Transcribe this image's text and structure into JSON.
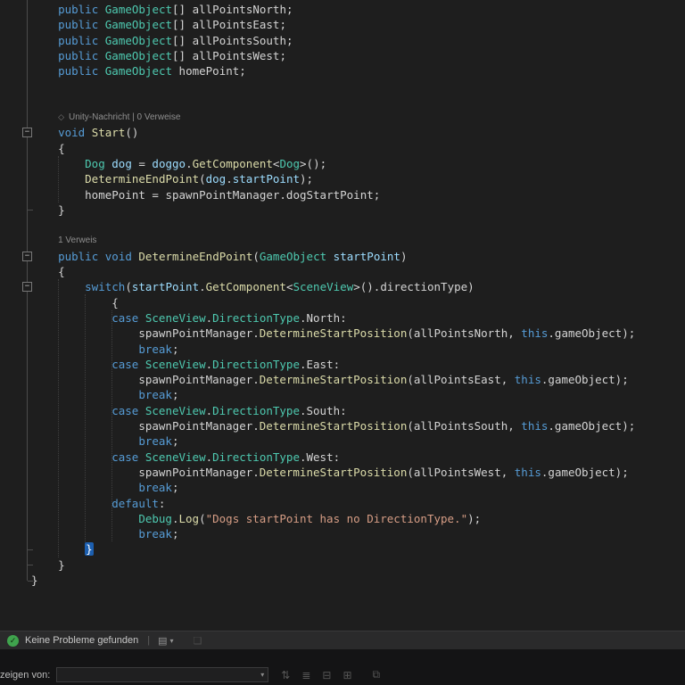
{
  "colors": {
    "editor-bg": "#1E1E1E",
    "kw": "#569CD6",
    "ty": "#4EC9B0",
    "fn": "#DCDCAA",
    "var": "#9CDCFE",
    "str": "#D69D85",
    "pl": "#D4D4D4",
    "lens": "#8F8F8F",
    "brace-hl-bg": "#1C5FB0",
    "check-green": "#3FA34D"
  },
  "editor": {
    "fold_glyph": "−",
    "lens_icon_glyph": "◇",
    "lines": [
      {
        "i": 4,
        "s": [
          [
            "public",
            "kw"
          ],
          [
            " ",
            "pl"
          ],
          [
            "GameObject",
            "ty"
          ],
          [
            "[] ",
            "pl"
          ],
          [
            "allPointsNorth;",
            "pl"
          ]
        ]
      },
      {
        "i": 4,
        "s": [
          [
            "public",
            "kw"
          ],
          [
            " ",
            "pl"
          ],
          [
            "GameObject",
            "ty"
          ],
          [
            "[] ",
            "pl"
          ],
          [
            "allPointsEast;",
            "pl"
          ]
        ]
      },
      {
        "i": 4,
        "s": [
          [
            "public",
            "kw"
          ],
          [
            " ",
            "pl"
          ],
          [
            "GameObject",
            "ty"
          ],
          [
            "[] ",
            "pl"
          ],
          [
            "allPointsSouth;",
            "pl"
          ]
        ]
      },
      {
        "i": 4,
        "s": [
          [
            "public",
            "kw"
          ],
          [
            " ",
            "pl"
          ],
          [
            "GameObject",
            "ty"
          ],
          [
            "[] ",
            "pl"
          ],
          [
            "allPointsWest;",
            "pl"
          ]
        ]
      },
      {
        "i": 4,
        "s": [
          [
            "public",
            "kw"
          ],
          [
            " ",
            "pl"
          ],
          [
            "GameObject",
            "ty"
          ],
          [
            " homePoint;",
            "pl"
          ]
        ]
      },
      {
        "t": "blank"
      },
      {
        "t": "blank"
      },
      {
        "t": "lens",
        "i": 4,
        "icon": true,
        "text": "Unity-Nachricht | 0 Verweise"
      },
      {
        "i": 4,
        "s": [
          [
            "void",
            "kw"
          ],
          [
            " ",
            "pl"
          ],
          [
            "Start",
            "fn"
          ],
          [
            "()",
            "pl"
          ]
        ]
      },
      {
        "i": 4,
        "s": [
          [
            "{",
            "pl"
          ]
        ]
      },
      {
        "i": 8,
        "s": [
          [
            "Dog",
            "ty"
          ],
          [
            " ",
            "pl"
          ],
          [
            "dog",
            "var"
          ],
          [
            " = ",
            "pl"
          ],
          [
            "doggo",
            "var"
          ],
          [
            ".",
            "pl"
          ],
          [
            "GetComponent",
            "fn"
          ],
          [
            "<",
            "pl"
          ],
          [
            "Dog",
            "ty"
          ],
          [
            ">();",
            "pl"
          ]
        ]
      },
      {
        "i": 8,
        "s": [
          [
            "DetermineEndPoint",
            "fn"
          ],
          [
            "(",
            "pl"
          ],
          [
            "dog",
            "var"
          ],
          [
            ".",
            "pl"
          ],
          [
            "startPoint",
            "var"
          ],
          [
            ");",
            "pl"
          ]
        ]
      },
      {
        "i": 8,
        "s": [
          [
            "homePoint = spawnPointManager.dogStartPoint;",
            "pl"
          ]
        ]
      },
      {
        "i": 4,
        "s": [
          [
            "}",
            "pl"
          ]
        ]
      },
      {
        "t": "blank"
      },
      {
        "t": "lens",
        "i": 4,
        "text": "1 Verweis"
      },
      {
        "i": 4,
        "s": [
          [
            "public",
            "kw"
          ],
          [
            " ",
            "pl"
          ],
          [
            "void",
            "kw"
          ],
          [
            " ",
            "pl"
          ],
          [
            "DetermineEndPoint",
            "fn"
          ],
          [
            "(",
            "pl"
          ],
          [
            "GameObject",
            "ty"
          ],
          [
            " ",
            "pl"
          ],
          [
            "startPoint",
            "var"
          ],
          [
            ")",
            "pl"
          ]
        ]
      },
      {
        "i": 4,
        "s": [
          [
            "{",
            "pl"
          ]
        ]
      },
      {
        "i": 8,
        "s": [
          [
            "switch",
            "kw"
          ],
          [
            "(",
            "pl"
          ],
          [
            "startPoint",
            "var"
          ],
          [
            ".",
            "pl"
          ],
          [
            "GetComponent",
            "fn"
          ],
          [
            "<",
            "pl"
          ],
          [
            "SceneView",
            "ty"
          ],
          [
            ">().directionType)",
            "pl"
          ]
        ]
      },
      {
        "i": 12,
        "s": [
          [
            "{",
            "pl"
          ]
        ]
      },
      {
        "i": 12,
        "s": [
          [
            "case",
            "kw"
          ],
          [
            " ",
            "pl"
          ],
          [
            "SceneView",
            "ty"
          ],
          [
            ".",
            "pl"
          ],
          [
            "DirectionType",
            "ty"
          ],
          [
            ".North:",
            "pl"
          ]
        ]
      },
      {
        "i": 16,
        "s": [
          [
            "spawnPointManager.",
            "pl"
          ],
          [
            "DetermineStartPosition",
            "fn"
          ],
          [
            "(allPointsNorth, ",
            "pl"
          ],
          [
            "this",
            "kw"
          ],
          [
            ".gameObject);",
            "pl"
          ]
        ]
      },
      {
        "i": 16,
        "s": [
          [
            "break",
            "kw"
          ],
          [
            ";",
            "pl"
          ]
        ]
      },
      {
        "i": 12,
        "s": [
          [
            "case",
            "kw"
          ],
          [
            " ",
            "pl"
          ],
          [
            "SceneView",
            "ty"
          ],
          [
            ".",
            "pl"
          ],
          [
            "DirectionType",
            "ty"
          ],
          [
            ".East:",
            "pl"
          ]
        ]
      },
      {
        "i": 16,
        "s": [
          [
            "spawnPointManager.",
            "pl"
          ],
          [
            "DetermineStartPosition",
            "fn"
          ],
          [
            "(allPointsEast, ",
            "pl"
          ],
          [
            "this",
            "kw"
          ],
          [
            ".gameObject);",
            "pl"
          ]
        ]
      },
      {
        "i": 16,
        "s": [
          [
            "break",
            "kw"
          ],
          [
            ";",
            "pl"
          ]
        ]
      },
      {
        "i": 12,
        "s": [
          [
            "case",
            "kw"
          ],
          [
            " ",
            "pl"
          ],
          [
            "SceneView",
            "ty"
          ],
          [
            ".",
            "pl"
          ],
          [
            "DirectionType",
            "ty"
          ],
          [
            ".South:",
            "pl"
          ]
        ]
      },
      {
        "i": 16,
        "s": [
          [
            "spawnPointManager.",
            "pl"
          ],
          [
            "DetermineStartPosition",
            "fn"
          ],
          [
            "(allPointsSouth, ",
            "pl"
          ],
          [
            "this",
            "kw"
          ],
          [
            ".gameObject);",
            "pl"
          ]
        ]
      },
      {
        "i": 16,
        "s": [
          [
            "break",
            "kw"
          ],
          [
            ";",
            "pl"
          ]
        ]
      },
      {
        "i": 12,
        "s": [
          [
            "case",
            "kw"
          ],
          [
            " ",
            "pl"
          ],
          [
            "SceneView",
            "ty"
          ],
          [
            ".",
            "pl"
          ],
          [
            "DirectionType",
            "ty"
          ],
          [
            ".West:",
            "pl"
          ]
        ]
      },
      {
        "i": 16,
        "s": [
          [
            "spawnPointManager.",
            "pl"
          ],
          [
            "DetermineStartPosition",
            "fn"
          ],
          [
            "(allPointsWest, ",
            "pl"
          ],
          [
            "this",
            "kw"
          ],
          [
            ".gameObject);",
            "pl"
          ]
        ]
      },
      {
        "i": 16,
        "s": [
          [
            "break",
            "kw"
          ],
          [
            ";",
            "pl"
          ]
        ]
      },
      {
        "i": 12,
        "s": [
          [
            "default",
            "kw"
          ],
          [
            ":",
            "pl"
          ]
        ]
      },
      {
        "i": 16,
        "s": [
          [
            "Debug",
            "ty"
          ],
          [
            ".",
            "pl"
          ],
          [
            "Log",
            "fn"
          ],
          [
            "(",
            "pl"
          ],
          [
            "\"Dogs startPoint has no DirectionType.\"",
            "str"
          ],
          [
            ");",
            "pl"
          ]
        ]
      },
      {
        "i": 16,
        "s": [
          [
            "break",
            "kw"
          ],
          [
            ";",
            "pl"
          ]
        ]
      },
      {
        "i": 8,
        "s": [
          [
            "}",
            "hl"
          ]
        ]
      },
      {
        "i": 4,
        "s": [
          [
            "}",
            "pl"
          ]
        ]
      },
      {
        "i": 0,
        "s": [
          [
            "}",
            "pl"
          ]
        ]
      }
    ]
  },
  "problems_bar": {
    "check_glyph": "✓",
    "status_text": "Keine Probleme gefunden",
    "separator": "|",
    "view_icon_glyph": "▤",
    "chevron_glyph": "▾",
    "columns_icon_glyph": "❏"
  },
  "bottom_panel": {
    "show_from_label": "zeigen von:",
    "dropdown_value": "",
    "combobox_chevron": "▾",
    "icons": [
      {
        "name": "sort-icon",
        "glyph": "⇅"
      },
      {
        "name": "list-view-icon",
        "glyph": "≣"
      },
      {
        "name": "collapse-all-icon",
        "glyph": "⊟"
      },
      {
        "name": "expand-all-icon",
        "glyph": "⊞"
      },
      {
        "name": "dock-panel-icon",
        "glyph": "⧉",
        "gap": true
      }
    ]
  }
}
